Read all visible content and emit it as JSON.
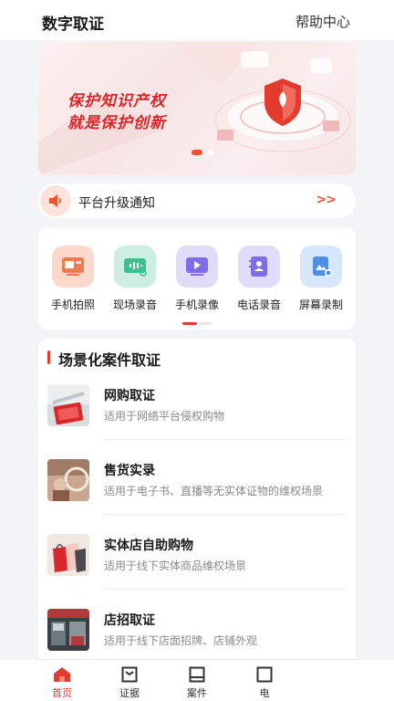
{
  "header": {
    "title": "数字取证",
    "help": "帮助中心"
  },
  "banner": {
    "line1": "保护知识产权",
    "line2": "就是保护创新"
  },
  "notice": {
    "text": "平台升级通知",
    "more": ">>"
  },
  "tools": [
    {
      "label": "手机拍照",
      "icon": "photo-icon",
      "bg": "#ffd8cc",
      "fg": "#f07a52"
    },
    {
      "label": "现场录音",
      "icon": "audio-wave-icon",
      "bg": "#cdeee0",
      "fg": "#3fbf8e"
    },
    {
      "label": "手机录像",
      "icon": "video-play-icon",
      "bg": "#e2dcfb",
      "fg": "#7d6ee8"
    },
    {
      "label": "电话录音",
      "icon": "contact-book-icon",
      "bg": "#e2dcfb",
      "fg": "#7d6ee8"
    },
    {
      "label": "屏幕录制",
      "icon": "screen-record-icon",
      "bg": "#d6e6fb",
      "fg": "#4b8fe8"
    }
  ],
  "cases": {
    "title": "场景化案件取证",
    "items": [
      {
        "name": "网购取证",
        "desc": "适用于网络平台侵权购物"
      },
      {
        "name": "售货实录",
        "desc": "适用于电子书、直播等无实体证物的维权场景"
      },
      {
        "name": "实体店自助购物",
        "desc": "适用于线下实体商品维权场景"
      },
      {
        "name": "店招取证",
        "desc": "适用于线下店面招牌、店铺外观"
      }
    ]
  },
  "tabbar": [
    {
      "label": "首页",
      "icon": "home-icon",
      "active": true
    },
    {
      "label": "证据",
      "icon": "evidence-icon",
      "active": false
    },
    {
      "label": "案件",
      "icon": "case-icon",
      "active": false
    },
    {
      "label": "电",
      "icon": "more-icon",
      "active": false
    }
  ],
  "colors": {
    "accent": "#e33b2e",
    "orange": "#e8532c"
  }
}
